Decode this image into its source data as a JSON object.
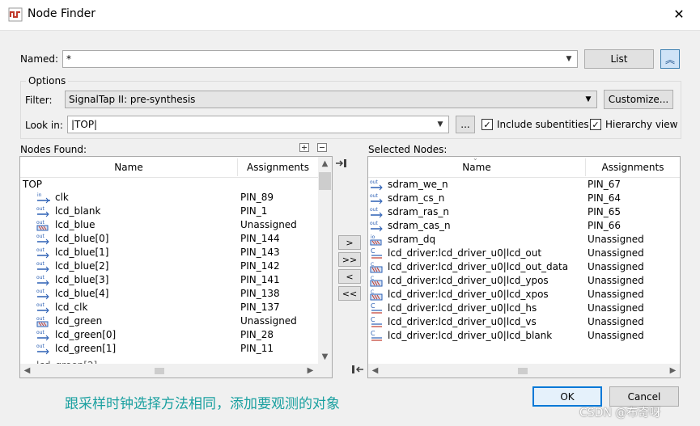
{
  "window": {
    "title": "Node Finder",
    "close_glyph": "✕"
  },
  "named": {
    "label": "Named:",
    "value": "*",
    "list_button": "List",
    "collapse_glyph": "︽"
  },
  "options": {
    "legend": "Options",
    "filter_label": "Filter:",
    "filter_value": "SignalTap II: pre-synthesis",
    "customize_button": "Customize...",
    "lookin_label": "Look in:",
    "lookin_value": "|TOP|",
    "browse_button": "...",
    "include_subentities": {
      "label": "Include subentities",
      "checked": true
    },
    "hierarchy_view": {
      "label": "Hierarchy view",
      "checked": true
    }
  },
  "nodes_found": {
    "label": "Nodes Found:",
    "col_name": "Name",
    "col_assign": "Assignments",
    "root": "TOP",
    "rows": [
      {
        "icon": "input-pin-icon",
        "name": "clk",
        "assign": "PIN_89"
      },
      {
        "icon": "output-pin-icon",
        "name": "lcd_blank",
        "assign": "PIN_1"
      },
      {
        "icon": "output-bus-icon",
        "name": "lcd_blue",
        "assign": "Unassigned"
      },
      {
        "icon": "output-pin-icon",
        "name": "lcd_blue[0]",
        "assign": "PIN_144"
      },
      {
        "icon": "output-pin-icon",
        "name": "lcd_blue[1]",
        "assign": "PIN_143"
      },
      {
        "icon": "output-pin-icon",
        "name": "lcd_blue[2]",
        "assign": "PIN_142"
      },
      {
        "icon": "output-pin-icon",
        "name": "lcd_blue[3]",
        "assign": "PIN_141"
      },
      {
        "icon": "output-pin-icon",
        "name": "lcd_blue[4]",
        "assign": "PIN_138"
      },
      {
        "icon": "output-pin-icon",
        "name": "lcd_clk",
        "assign": "PIN_137"
      },
      {
        "icon": "output-bus-icon",
        "name": "lcd_green",
        "assign": "Unassigned"
      },
      {
        "icon": "output-pin-icon",
        "name": "lcd_green[0]",
        "assign": "PIN_28"
      },
      {
        "icon": "output-pin-icon",
        "name": "lcd_green[1]",
        "assign": "PIN_11"
      }
    ]
  },
  "selected_nodes": {
    "label": "Selected Nodes:",
    "col_name": "Name",
    "col_assign": "Assignments",
    "rows": [
      {
        "icon": "output-pin-icon",
        "name": "sdram_we_n",
        "assign": "PIN_67"
      },
      {
        "icon": "output-pin-icon",
        "name": "sdram_cs_n",
        "assign": "PIN_64"
      },
      {
        "icon": "output-pin-icon",
        "name": "sdram_ras_n",
        "assign": "PIN_65"
      },
      {
        "icon": "output-pin-icon",
        "name": "sdram_cas_n",
        "assign": "PIN_66"
      },
      {
        "icon": "bidir-bus-icon",
        "name": "sdram_dq",
        "assign": "Unassigned"
      },
      {
        "icon": "combinational-icon",
        "name": "lcd_driver:lcd_driver_u0|lcd_out",
        "assign": "Unassigned"
      },
      {
        "icon": "register-bus-icon",
        "name": "lcd_driver:lcd_driver_u0|lcd_out_data",
        "assign": "Unassigned"
      },
      {
        "icon": "register-bus-icon",
        "name": "lcd_driver:lcd_driver_u0|lcd_ypos",
        "assign": "Unassigned"
      },
      {
        "icon": "register-bus-icon",
        "name": "lcd_driver:lcd_driver_u0|lcd_xpos",
        "assign": "Unassigned"
      },
      {
        "icon": "combinational-icon",
        "name": "lcd_driver:lcd_driver_u0|lcd_hs",
        "assign": "Unassigned"
      },
      {
        "icon": "combinational-icon",
        "name": "lcd_driver:lcd_driver_u0|lcd_vs",
        "assign": "Unassigned"
      },
      {
        "icon": "combinational-icon",
        "name": "lcd_driver:lcd_driver_u0|lcd_blank",
        "assign": "Unassigned"
      }
    ]
  },
  "move_buttons": {
    "add_one": ">",
    "add_all": ">>",
    "remove_one": "<",
    "remove_all": "<<"
  },
  "footer": {
    "ok_button": "OK",
    "cancel_button": "Cancel",
    "caption": "跟采样时钟选择方法相同，添加要观测的对象",
    "watermark": "CSDN @布奇呀"
  },
  "colors": {
    "caption": "#1aa0a0",
    "ok_border": "#0078d7",
    "icon_blue": "#2b5fb4",
    "icon_red": "#c0392b"
  }
}
